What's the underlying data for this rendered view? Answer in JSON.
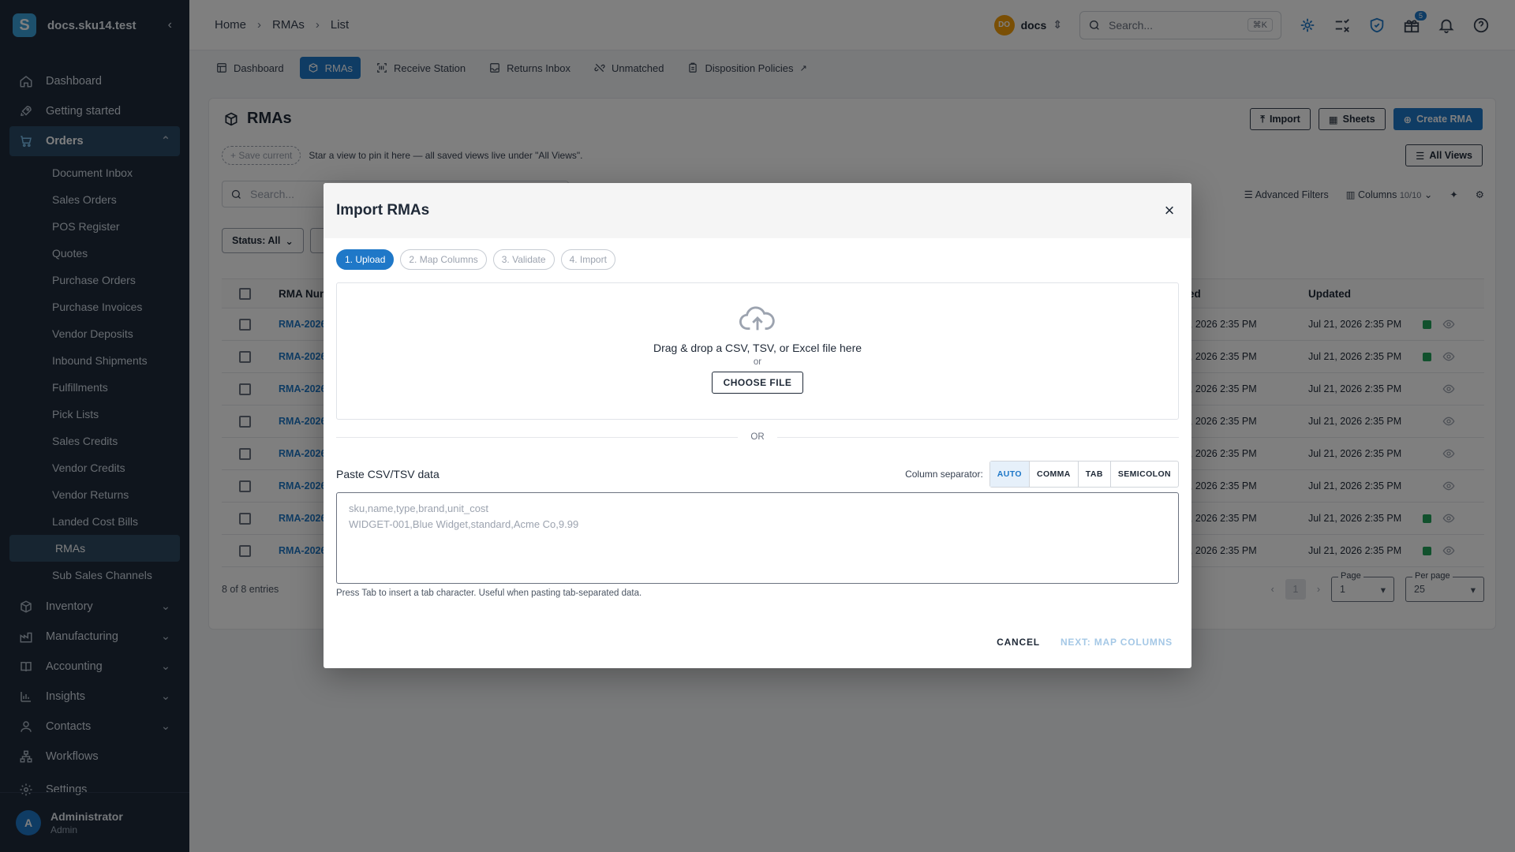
{
  "sidebar": {
    "brand": "docs.sku14.test",
    "items": [
      {
        "label": "Dashboard",
        "icon": "home-icon"
      },
      {
        "label": "Getting started",
        "icon": "rocket-icon"
      }
    ],
    "orders": {
      "label": "Orders",
      "sub": [
        "Document Inbox",
        "Sales Orders",
        "POS Register",
        "Quotes",
        "Purchase Orders",
        "Purchase Invoices",
        "Vendor Deposits",
        "Inbound Shipments",
        "Fulfillments",
        "Pick Lists",
        "Sales Credits",
        "Vendor Credits",
        "Vendor Returns",
        "Landed Cost Bills",
        "RMAs",
        "Sub Sales Channels"
      ]
    },
    "sections": [
      "Inventory",
      "Manufacturing",
      "Accounting",
      "Insights",
      "Contacts"
    ],
    "bottom": [
      "Workflows",
      "Settings"
    ],
    "user": {
      "initial": "A",
      "name": "Administrator",
      "role": "Admin"
    }
  },
  "topbar": {
    "crumbs": [
      "Home",
      "RMAs",
      "List"
    ],
    "org_initials": "DO",
    "org_name": "docs",
    "search_placeholder": "Search...",
    "shortcut": "⌘K",
    "gift_badge": "5"
  },
  "tabs": [
    "Dashboard",
    "RMAs",
    "Receive Station",
    "Returns Inbox",
    "Unmatched",
    "Disposition Policies"
  ],
  "page": {
    "title": "RMAs",
    "import": "Import",
    "sheets": "Sheets",
    "create": "Create RMA",
    "save_current": "+ Save current",
    "views_hint": "Star a view to pin it here — all saved views live under \"All Views\".",
    "all_views": "All Views",
    "search_placeholder": "Search...",
    "advanced_filters": "Advanced Filters",
    "columns": "Columns",
    "columns_count": "10/10",
    "status_filter": "Status: All",
    "col_number": "RMA Num",
    "col_created": "ated",
    "col_updated": "Updated",
    "rows": [
      {
        "num": "RMA-2026",
        "created": "21, 2026 2:35 PM",
        "updated": "Jul 21, 2026 2:35 PM",
        "flag": true
      },
      {
        "num": "RMA-2026",
        "created": "21, 2026 2:35 PM",
        "updated": "Jul 21, 2026 2:35 PM",
        "flag": true
      },
      {
        "num": "RMA-2026",
        "created": "21, 2026 2:35 PM",
        "updated": "Jul 21, 2026 2:35 PM",
        "flag": false
      },
      {
        "num": "RMA-2026",
        "created": "21, 2026 2:35 PM",
        "updated": "Jul 21, 2026 2:35 PM",
        "flag": false
      },
      {
        "num": "RMA-2026",
        "created": "21, 2026 2:35 PM",
        "updated": "Jul 21, 2026 2:35 PM",
        "flag": false
      },
      {
        "num": "RMA-2026",
        "created": "21, 2026 2:35 PM",
        "updated": "Jul 21, 2026 2:35 PM",
        "flag": false
      },
      {
        "num": "RMA-2026",
        "created": "21, 2026 2:35 PM",
        "updated": "Jul 21, 2026 2:35 PM",
        "flag": true
      },
      {
        "num": "RMA-2026",
        "created": "21, 2026 2:35 PM",
        "updated": "Jul 21, 2026 2:35 PM",
        "flag": true
      }
    ],
    "entries": "8 of 8 entries",
    "page_label": "Page",
    "page_value": "1",
    "per_page_label": "Per page",
    "per_page_value": "25",
    "current_page": "1"
  },
  "modal": {
    "title": "Import RMAs",
    "steps": [
      "1. Upload",
      "2. Map Columns",
      "3. Validate",
      "4. Import"
    ],
    "drop_text": "Drag & drop a CSV, TSV, or Excel file here",
    "drop_or": "or",
    "choose_file": "CHOOSE FILE",
    "divider_or": "OR",
    "paste_label": "Paste CSV/TSV data",
    "separator_label": "Column separator:",
    "separators": [
      "AUTO",
      "COMMA",
      "TAB",
      "SEMICOLON"
    ],
    "textarea_placeholder": "sku,name,type,brand,unit_cost\nWIDGET-001,Blue Widget,standard,Acme Co,9.99",
    "help": "Press Tab to insert a tab character. Useful when pasting tab-separated data.",
    "cancel": "CANCEL",
    "next": "NEXT: MAP COLUMNS"
  },
  "colors": {
    "accent": "#1f78c8",
    "sidebar": "#1e2a3a",
    "success": "#22a35a"
  }
}
